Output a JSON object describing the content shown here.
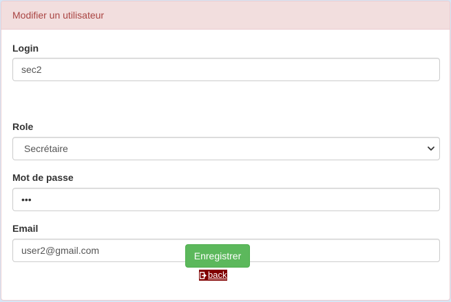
{
  "panel": {
    "title": "Modifier un utilisateur"
  },
  "form": {
    "login": {
      "label": "Login",
      "value": "sec2"
    },
    "role": {
      "label": "Role",
      "selected": "Secrétaire"
    },
    "password": {
      "label": "Mot de passe",
      "masked_value": "•••"
    },
    "email": {
      "label": "Email",
      "value": "user2@gmail.com"
    }
  },
  "actions": {
    "save_label": "Enregistrer",
    "back_label": "back"
  },
  "icons": {
    "select": "chevron-down-icon",
    "back": "sign-out-icon"
  },
  "colors": {
    "heading_bg": "#f2dede",
    "heading_text": "#a94442",
    "save_button": "#5cb85c",
    "back_link_bg": "#800000"
  }
}
